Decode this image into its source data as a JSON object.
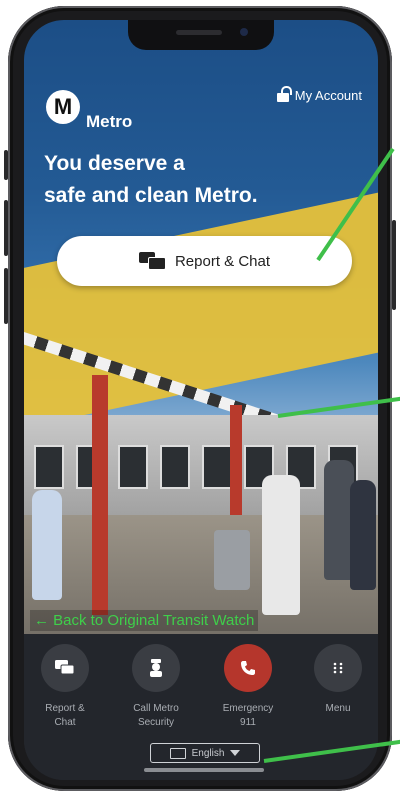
{
  "header": {
    "logo_letter": "M",
    "brand": "Metro",
    "account_label": "My Account"
  },
  "hero": {
    "headline_line1": "You deserve a",
    "headline_line2": "safe and clean Metro."
  },
  "cta": {
    "report_chat_label": "Report & Chat"
  },
  "back_link": "← Back to Original Transit Watch",
  "bottom_nav": [
    {
      "label_line1": "Report &",
      "label_line2": "Chat",
      "icon": "chat-icon"
    },
    {
      "label_line1": "Call Metro",
      "label_line2": "Security",
      "icon": "security-officer-icon"
    },
    {
      "label_line1": "Emergency",
      "label_line2": "911",
      "icon": "phone-icon"
    },
    {
      "label_line1": "Menu",
      "label_line2": "",
      "icon": "grid-menu-icon"
    }
  ],
  "language": {
    "selected": "English"
  },
  "colors": {
    "accent_green": "#3fbf4a",
    "emergency_red": "#b5362c",
    "nav_background": "#23262c"
  }
}
